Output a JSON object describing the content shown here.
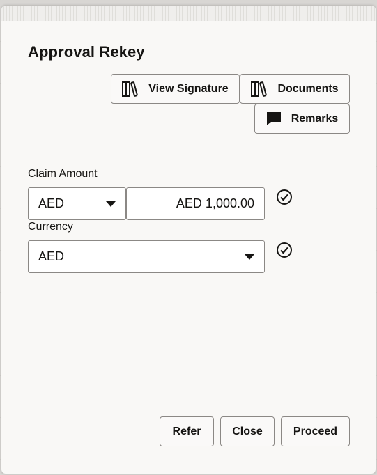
{
  "dialog": {
    "title": "Approval Rekey"
  },
  "toolbar": {
    "view_signature_label": "View Signature",
    "documents_label": "Documents",
    "remarks_label": "Remarks"
  },
  "form": {
    "claim_amount_label": "Claim Amount",
    "claim_currency_value": "AED",
    "claim_amount_value": "AED 1,000.00",
    "currency_label": "Currency",
    "currency_value": "AED"
  },
  "footer": {
    "refer_label": "Refer",
    "close_label": "Close",
    "proceed_label": "Proceed"
  },
  "icons": {
    "view_signature": "library-books-icon",
    "documents": "library-books-icon",
    "remarks": "speech-bubble-icon",
    "validated": "check-circle-icon",
    "dropdown": "caret-down-icon"
  }
}
